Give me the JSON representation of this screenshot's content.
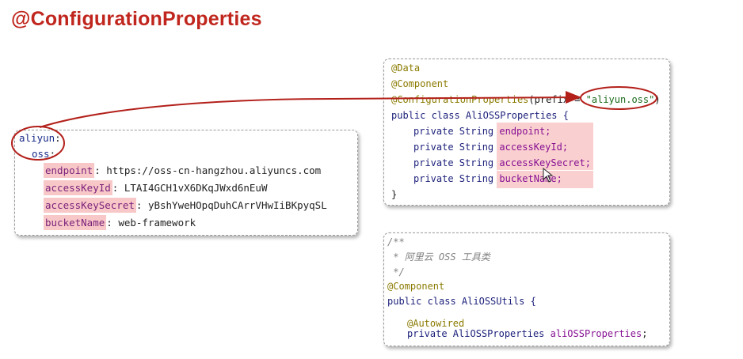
{
  "title": "@ConfigurationProperties",
  "yaml": {
    "root_key": "aliyun",
    "sub_key": "oss",
    "entries": [
      {
        "key": "endpoint",
        "value": "https://oss-cn-hangzhou.aliyuncs.com"
      },
      {
        "key": "accessKeyId",
        "value": "LTAI4GCH1vX6DKqJWxd6nEuW"
      },
      {
        "key": "accessKeySecret",
        "value": "yBshYweHOpqDuhCArrVHwIiBKpyqSL"
      },
      {
        "key": "bucketName",
        "value": "web-framework"
      }
    ]
  },
  "props_code": {
    "annotation1": "@Data",
    "annotation2": "@Component",
    "annotation3": "@ConfigurationProperties",
    "prefix_text": "(prefix = ",
    "prefix_value": "\"aliyun.oss\"",
    "close_paren": ")",
    "class_decl": "public class AliOSSProperties {",
    "field_prefix": "private String ",
    "fields": [
      "endpoint;",
      "accessKeyId;",
      "accessKeySecret;",
      "bucketName;"
    ],
    "close_brace": "}"
  },
  "utils_code": {
    "comment1": "/**",
    "comment2": " * 阿里云 OSS 工具类",
    "comment3": " */",
    "annotation": "@Component",
    "class_decl": "public class AliOSSUtils {",
    "autowired": "@Autowired",
    "field_decl_prefix": "private AliOSSProperties ",
    "field_name": "aliOSSProperties",
    "field_end": ";"
  },
  "colors": {
    "title": "#c0261d",
    "highlight": "#f8c8c8",
    "arrow": "#b3201a"
  }
}
